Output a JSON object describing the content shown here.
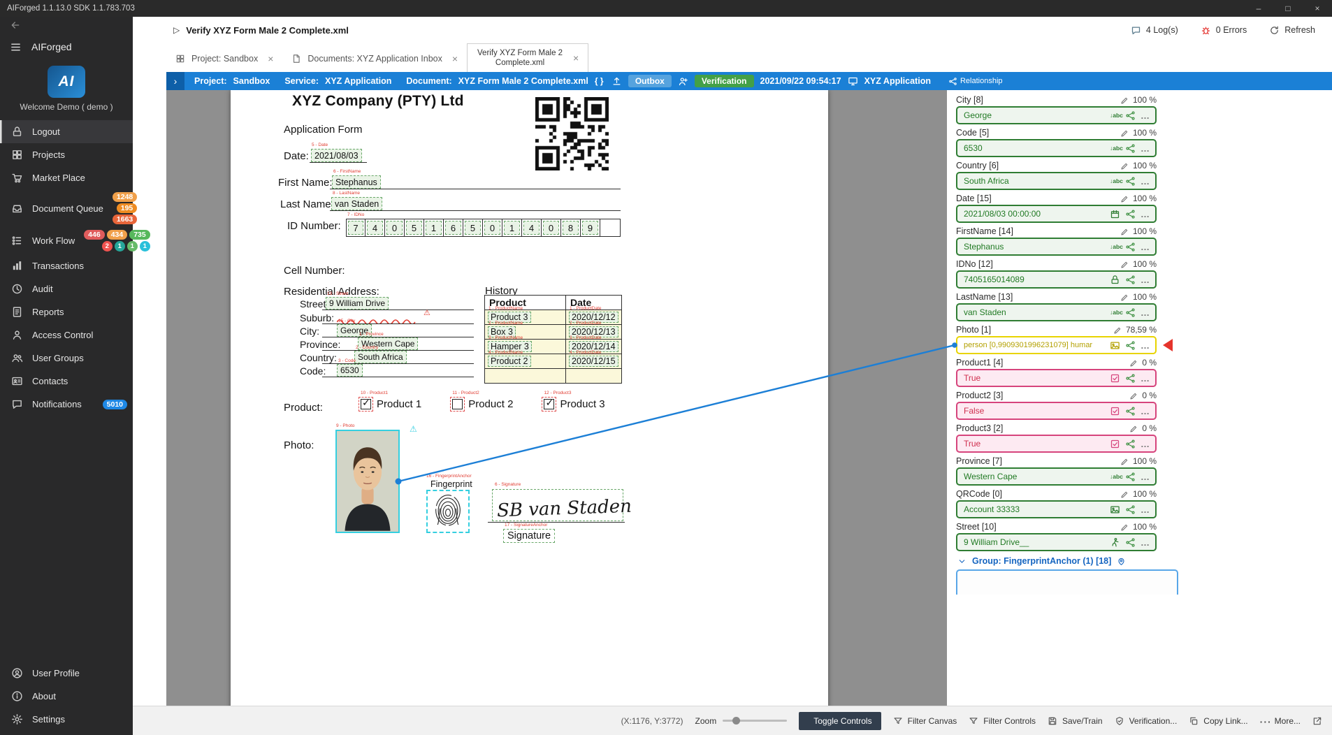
{
  "titlebar": {
    "title": "AIForged  1.1.13.0  SDK 1.1.783.703"
  },
  "window_controls": {
    "minimize": "–",
    "maximize": "□",
    "close": "×"
  },
  "sidebar": {
    "brand": "AIForged",
    "logo_text": "AI",
    "welcome": "Welcome Demo ( demo )",
    "items": [
      {
        "id": "logout",
        "label": "Logout",
        "icon": "lock",
        "selected": true
      },
      {
        "id": "projects",
        "label": "Projects",
        "icon": "grid"
      },
      {
        "id": "market-place",
        "label": "Market Place",
        "icon": "cart"
      },
      {
        "id": "document-queue",
        "label": "Document Queue",
        "icon": "tray",
        "badge_lines": [
          [
            {
              "t": "1248",
              "c": "#f0a04a"
            }
          ],
          [
            {
              "t": "195",
              "c": "#ee8c22"
            }
          ],
          [
            {
              "t": "1663",
              "c": "#e8653a"
            }
          ]
        ]
      },
      {
        "id": "work-flow",
        "label": "Work Flow",
        "icon": "flowlist",
        "badge_lines": [
          [
            {
              "t": "446",
              "c": "#e05c5c"
            },
            {
              "t": "434",
              "c": "#f0a04a"
            },
            {
              "t": "735",
              "c": "#57b85c"
            }
          ],
          [
            {
              "t": "2",
              "c": "#ef5350",
              "dot": true
            },
            {
              "t": "1",
              "c": "#26a69a",
              "dot": true
            },
            {
              "t": "1",
              "c": "#66bb6a",
              "dot": true
            },
            {
              "t": "1",
              "c": "#29c0da",
              "dot": true
            }
          ]
        ]
      },
      {
        "id": "transactions",
        "label": "Transactions",
        "icon": "chart"
      },
      {
        "id": "audit",
        "label": "Audit",
        "icon": "clock"
      },
      {
        "id": "reports",
        "label": "Reports",
        "icon": "report"
      },
      {
        "id": "access-control",
        "label": "Access Control",
        "icon": "person"
      },
      {
        "id": "user-groups",
        "label": "User Groups",
        "icon": "people"
      },
      {
        "id": "contacts",
        "label": "Contacts",
        "icon": "card"
      },
      {
        "id": "notifications",
        "label": "Notifications",
        "icon": "chat",
        "badge_lines": [
          [
            {
              "t": "5010",
              "c": "#1e88e5"
            }
          ]
        ]
      }
    ],
    "footer_items": [
      {
        "id": "user-profile",
        "label": "User Profile",
        "icon": "person-circle"
      },
      {
        "id": "about",
        "label": "About",
        "icon": "info"
      },
      {
        "id": "settings",
        "label": "Settings",
        "icon": "gear"
      }
    ]
  },
  "header": {
    "run_icon": "▷",
    "title": "Verify XYZ Form Male 2 Complete.xml",
    "logs": "4 Log(s)",
    "errors": "0 Errors",
    "refresh": "Refresh"
  },
  "tabs": [
    {
      "label": "Project: Sandbox",
      "icon": "grid"
    },
    {
      "label": "Documents: XYZ Application Inbox",
      "icon": "doc"
    },
    {
      "label": "Verify XYZ Form Male 2 Complete.xml",
      "icon": "",
      "active": true
    }
  ],
  "toolbar": {
    "collapse": "›",
    "project_label": "Project:",
    "project": "Sandbox",
    "service_label": "Service:",
    "service": "XYZ Application",
    "document_label": "Document:",
    "document": "XYZ Form Male 2 Complete.xml",
    "braces": "{ }",
    "status": "Outbox",
    "stage": "Verification",
    "timestamp": "2021/09/22 09:54:17",
    "app_name": "XYZ Application",
    "relationship": "Relationship"
  },
  "document": {
    "title": "XYZ Company (PTY) Ltd",
    "subtitle": "Application Form",
    "date_label": "Date:",
    "date_value": "2021/08/03",
    "date_anno": "5 - Date",
    "first_name_label": "First Name:",
    "first_name_value": "Stephanus",
    "first_name_anno": "6 - FirstName",
    "last_name_label": "Last Name:",
    "last_name_value": "van Staden",
    "last_name_anno": "8 - LastName",
    "id_label": "ID Number:",
    "id_anno": "7 - IDNo",
    "id_digits": [
      "7",
      "4",
      "0",
      "5",
      "1",
      "6",
      "5",
      "0",
      "1",
      "4",
      "0",
      "8",
      "9"
    ],
    "cell_label": "Cell Number:",
    "address_label": "Residential Address:",
    "street_label": "Street:",
    "street_value": "9 William Drive",
    "street_anno": "13 - Street",
    "suburb_label": "Suburb:",
    "city_label": "City:",
    "city_value": "George",
    "city_anno": "15 - City",
    "province_label": "Province:",
    "province_value": "Western Cape",
    "province_anno": "1 - Province",
    "country_label": "Country:",
    "country_value": "South Africa",
    "country_anno": "2 - Country",
    "code_label": "Code:",
    "code_value": "6530",
    "code_anno": "3 - Code",
    "history_title": "History",
    "history_headers": [
      "Product",
      "Date"
    ],
    "history_rows": [
      {
        "product": "Product 3",
        "date": "2020/12/12",
        "anno_p": "1 - ProductName",
        "anno_d": "1 - ProductDate"
      },
      {
        "product": "Box 3",
        "date": "2020/12/13",
        "anno_p": "2 - ProductName",
        "anno_d": "2 - ProductDate"
      },
      {
        "product": "Hamper 3",
        "date": "2020/12/14",
        "anno_p": "3 - ProductName",
        "anno_d": "3 - ProductDate"
      },
      {
        "product": "Product 2",
        "date": "2020/12/15",
        "anno_p": "4 - ProductName",
        "anno_d": "4 - ProductDate"
      }
    ],
    "product_label": "Product:",
    "products": [
      {
        "label": "Product 1",
        "anno": "10 - Product1",
        "checked": true
      },
      {
        "label": "Product 2",
        "anno": "11 - Product2",
        "checked": false
      },
      {
        "label": "Product 3",
        "anno": "12 - Product3",
        "checked": true
      }
    ],
    "photo_label": "Photo:",
    "photo_anno": "9 - Photo",
    "fingerprint_label": "Fingerprint",
    "fingerprint_anno": "16 - FingerprintAnchor",
    "signature_value": "SB van Staden",
    "signature_anno": "6 - Signature",
    "signature_caption": "Signature",
    "signature_caption_anno": "17 - SignatureAnchor"
  },
  "fields_panel": {
    "fields": [
      {
        "label": "City [8]",
        "percent": "100 %",
        "value": "George",
        "type_icon": "sort-alpha",
        "color": "green"
      },
      {
        "label": "Code [5]",
        "percent": "100 %",
        "value": "6530",
        "type_icon": "sort-alpha",
        "color": "green"
      },
      {
        "label": "Country [6]",
        "percent": "100 %",
        "value": "South Africa",
        "type_icon": "sort-alpha",
        "color": "green"
      },
      {
        "label": "Date [15]",
        "percent": "100 %",
        "value": "2021/08/03 00:00:00",
        "type_icon": "calendar",
        "color": "green"
      },
      {
        "label": "FirstName [14]",
        "percent": "100 %",
        "value": "Stephanus",
        "type_icon": "sort-alpha",
        "color": "green"
      },
      {
        "label": "IDNo [12]",
        "percent": "100 %",
        "value": "7405165014089",
        "type_icon": "lock",
        "color": "green"
      },
      {
        "label": "LastName [13]",
        "percent": "100 %",
        "value": "van Staden",
        "type_icon": "sort-alpha",
        "color": "green"
      },
      {
        "label": "Photo [1]",
        "percent": "78,59 %",
        "value": "person [0,9909301996231079] humar",
        "type_icon": "image",
        "color": "yellow"
      },
      {
        "label": "Product1 [4]",
        "percent": "0 %",
        "value": "True",
        "type_icon": "checkbox",
        "color": "pink"
      },
      {
        "label": "Product2 [3]",
        "percent": "0 %",
        "value": "False",
        "type_icon": "checkbox",
        "color": "pink"
      },
      {
        "label": "Product3 [2]",
        "percent": "0 %",
        "value": "True",
        "type_icon": "checkbox",
        "color": "pink"
      },
      {
        "label": "Province [7]",
        "percent": "100 %",
        "value": "Western Cape",
        "type_icon": "sort-alpha",
        "color": "green"
      },
      {
        "label": "QRCode [0]",
        "percent": "100 %",
        "value": "Account 33333",
        "type_icon": "image",
        "color": "green"
      },
      {
        "label": "Street [10]",
        "percent": "100 %",
        "value": "9 William Drive__",
        "type_icon": "walker",
        "color": "green"
      }
    ],
    "group_label": "Group: FingerprintAnchor (1) [18]"
  },
  "statusbar": {
    "coords": "(X:1176, Y:3772)",
    "zoom_label": "Zoom",
    "toggle_controls": "Toggle Controls",
    "filter_canvas": "Filter Canvas",
    "filter_controls": "Filter Controls",
    "save_train": "Save/Train",
    "verification": "Verification...",
    "copy_link": "Copy Link...",
    "more": "More..."
  },
  "colors": {
    "accent_blue": "#1b80d6",
    "field_green": "#2f7d33",
    "field_pink": "#d6447c",
    "field_yellow": "#e8d400",
    "verification_green": "#43a047",
    "error_red": "#e53935"
  }
}
